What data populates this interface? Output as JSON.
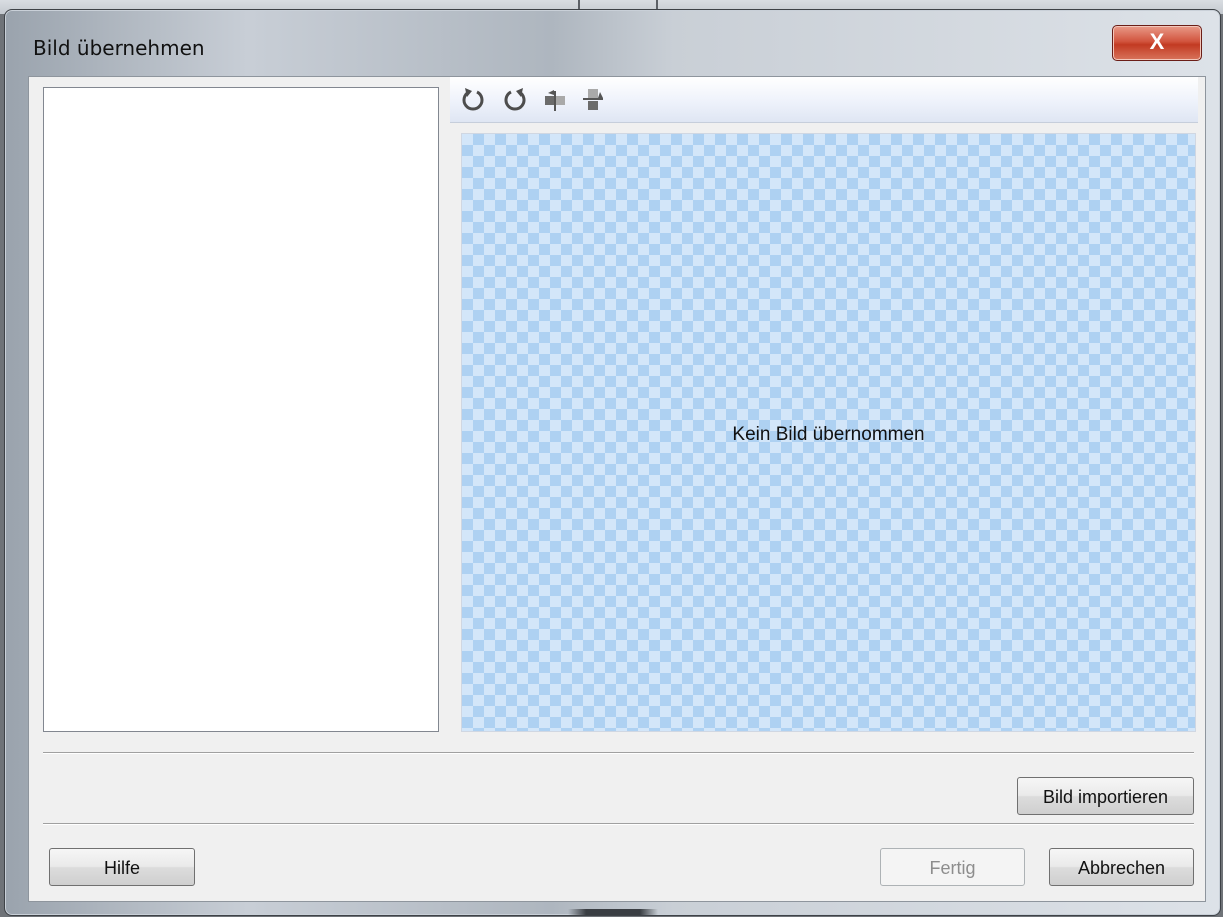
{
  "window": {
    "title": "Bild übernehmen",
    "close_glyph": "X",
    "close_icon": "close-icon"
  },
  "toolbar": {
    "icons": [
      "rotate-left-icon",
      "rotate-right-icon",
      "flip-horizontal-icon",
      "flip-vertical-icon"
    ]
  },
  "preview": {
    "message": "Kein Bild übernommen"
  },
  "buttons": {
    "import_label": "Bild importieren",
    "help_label": "Hilfe",
    "done_label": "Fertig",
    "cancel_label": "Abbrechen"
  },
  "colors": {
    "checker_light": "#d3e6f9",
    "checker_dark": "#aed1f2",
    "close_red": "#c23a22"
  }
}
